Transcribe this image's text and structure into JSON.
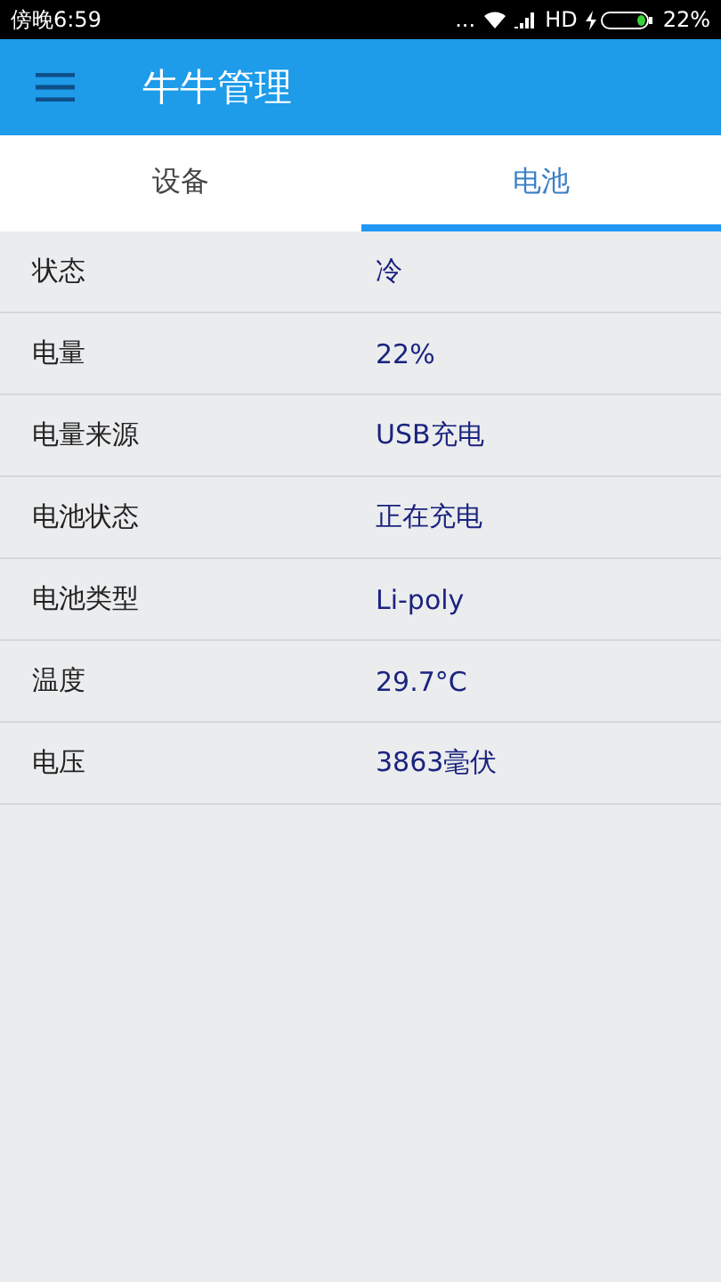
{
  "status_bar": {
    "time": "傍晚6:59",
    "more": "...",
    "network": "HD",
    "battery": "22%"
  },
  "app_bar": {
    "title": "牛牛管理"
  },
  "tabs": [
    {
      "label": "设备",
      "selected": false
    },
    {
      "label": "电池",
      "selected": true
    }
  ],
  "rows": [
    {
      "label": "状态",
      "value": "冷"
    },
    {
      "label": "电量",
      "value": "22%"
    },
    {
      "label": "电量来源",
      "value": "USB充电"
    },
    {
      "label": "电池状态",
      "value": "正在充电"
    },
    {
      "label": "电池类型",
      "value": "Li-poly"
    },
    {
      "label": "温度",
      "value": "29.7°C"
    },
    {
      "label": "电压",
      "value": "3863毫伏"
    }
  ]
}
